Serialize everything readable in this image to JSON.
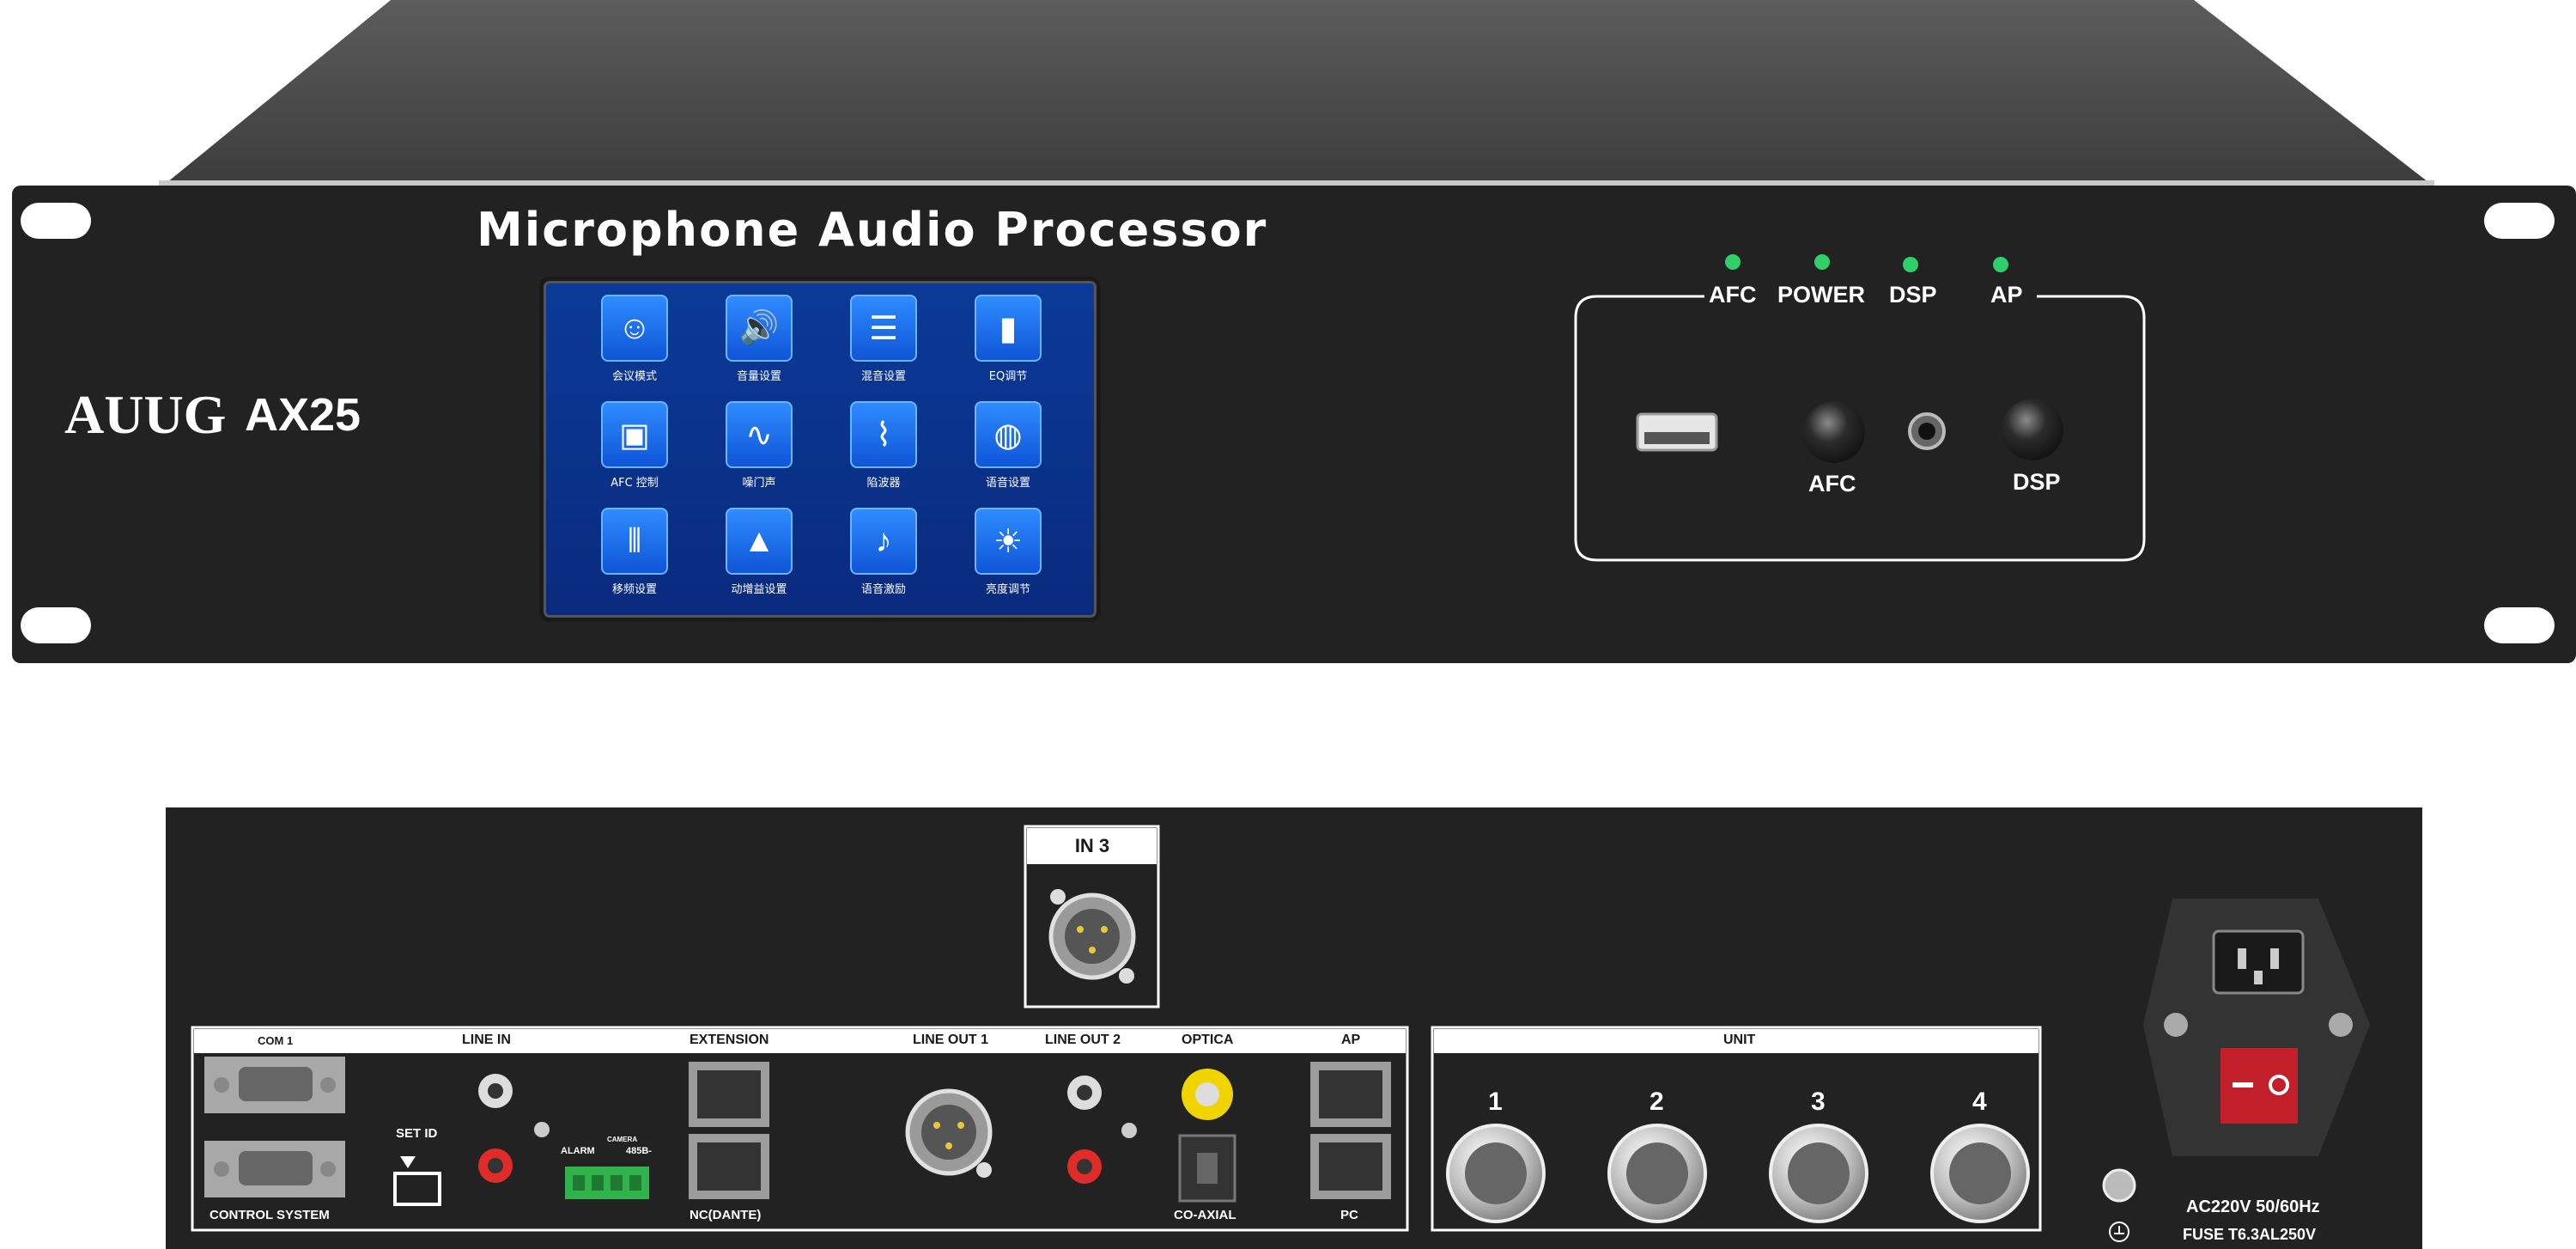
{
  "front": {
    "title": "Microphone Audio Processor",
    "brand": "AUUG",
    "model": "AX25",
    "indicators": [
      "AFC",
      "POWER",
      "DSP",
      "AP"
    ],
    "knob_labels": {
      "afc": "AFC",
      "dsp": "DSP"
    },
    "led_color": "#2fd06a"
  },
  "screen": {
    "apps": [
      {
        "label": "会议模式",
        "icon": "meeting-icon",
        "glyph": "☺"
      },
      {
        "label": "音量设置",
        "icon": "speaker-icon",
        "glyph": "🔊"
      },
      {
        "label": "混音设置",
        "icon": "mixer-icon",
        "glyph": "☰"
      },
      {
        "label": "EQ调节",
        "icon": "equalizer-icon",
        "glyph": "▮"
      },
      {
        "label": "AFC 控制",
        "icon": "afc-control-icon",
        "glyph": "▣"
      },
      {
        "label": "噪门声",
        "icon": "waveform-icon",
        "glyph": "∿"
      },
      {
        "label": "陷波器",
        "icon": "notch-filter-icon",
        "glyph": "⌇"
      },
      {
        "label": "语音设置",
        "icon": "globe-icon",
        "glyph": "◍"
      },
      {
        "label": "移频设置",
        "icon": "frequency-shift-icon",
        "glyph": "⦀"
      },
      {
        "label": "动增益设置",
        "icon": "gain-chart-icon",
        "glyph": "▲"
      },
      {
        "label": "语音激励",
        "icon": "microphone-icon",
        "glyph": "♪"
      },
      {
        "label": "亮度调节",
        "icon": "brightness-icon",
        "glyph": "☀"
      }
    ]
  },
  "rear": {
    "in3": "IN  3",
    "section_left": {
      "com1": "COM 1",
      "control_system": "CONTROL SYSTEM",
      "line_in": "LINE  IN",
      "set_id": "SET ID",
      "extension": "EXTENSION",
      "nc_dante": "NC(DANTE)",
      "alarm": "ALARM",
      "camera": "CAMERA",
      "rs485": "485B-",
      "line_out1": "LINE OUT 1",
      "line_out2": "LINE OUT 2",
      "optica": "OPTICA",
      "co_axial": "CO-AXIAL",
      "ap": "AP",
      "pc": "PC"
    },
    "unit": {
      "title": "UNIT",
      "numbers": [
        "1",
        "2",
        "3",
        "4"
      ]
    },
    "power": {
      "rating": "AC220V 50/60Hz",
      "fuse": "FUSE T6.3AL250V"
    }
  }
}
